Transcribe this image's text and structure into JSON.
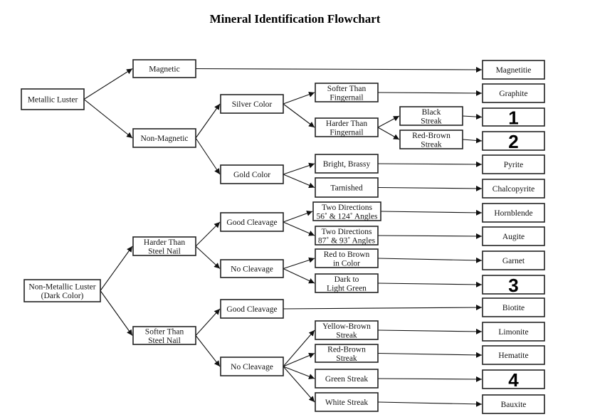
{
  "title": "Mineral Identification Flowchart",
  "nodes": [
    {
      "id": "metallic",
      "lines": [
        "Metallic Luster"
      ]
    },
    {
      "id": "magnetic",
      "lines": [
        "Magnetic"
      ]
    },
    {
      "id": "nonmagnetic",
      "lines": [
        "Non-Magnetic"
      ]
    },
    {
      "id": "silver",
      "lines": [
        "Silver Color"
      ]
    },
    {
      "id": "gold",
      "lines": [
        "Gold Color"
      ]
    },
    {
      "id": "softer_fingernail",
      "lines": [
        "Softer Than",
        "Fingernail"
      ]
    },
    {
      "id": "harder_fingernail",
      "lines": [
        "Harder Than",
        "Fingernail"
      ]
    },
    {
      "id": "black_streak",
      "lines": [
        "Black",
        "Streak"
      ]
    },
    {
      "id": "redbrown_streak_1",
      "lines": [
        "Red-Brown",
        "Streak"
      ]
    },
    {
      "id": "bright_brassy",
      "lines": [
        "Bright, Brassy"
      ]
    },
    {
      "id": "tarnished",
      "lines": [
        "Tarnished"
      ]
    },
    {
      "id": "nonmetallic",
      "lines": [
        "Non-Metallic Luster",
        "(Dark Color)"
      ]
    },
    {
      "id": "harder_nail",
      "lines": [
        "Harder Than",
        "Steel Nail"
      ]
    },
    {
      "id": "softer_nail",
      "lines": [
        "Softer Than",
        "Steel Nail"
      ]
    },
    {
      "id": "good_cleavage_1",
      "lines": [
        "Good Cleavage"
      ]
    },
    {
      "id": "no_cleavage_1",
      "lines": [
        "No Cleavage"
      ]
    },
    {
      "id": "good_cleavage_2",
      "lines": [
        "Good Cleavage"
      ]
    },
    {
      "id": "no_cleavage_2",
      "lines": [
        "No Cleavage"
      ]
    },
    {
      "id": "two_dir_56",
      "lines": [
        "Two Directions",
        "56˚ & 124˚ Angles"
      ]
    },
    {
      "id": "two_dir_87",
      "lines": [
        "Two Directions",
        "87˚ & 93˚ Angles"
      ]
    },
    {
      "id": "red_brown_color",
      "lines": [
        "Red to Brown",
        "in Color"
      ]
    },
    {
      "id": "dark_light_green",
      "lines": [
        "Dark to",
        "Light Green"
      ]
    },
    {
      "id": "yellowbrown_streak",
      "lines": [
        "Yellow-Brown",
        "Streak"
      ]
    },
    {
      "id": "redbrown_streak_2",
      "lines": [
        "Red-Brown",
        "Streak"
      ]
    },
    {
      "id": "green_streak",
      "lines": [
        "Green Streak"
      ]
    },
    {
      "id": "white_streak",
      "lines": [
        "White Streak"
      ]
    },
    {
      "id": "magnetitie",
      "lines": [
        "Magnetitie"
      ],
      "result": true
    },
    {
      "id": "graphite",
      "lines": [
        "Graphite"
      ],
      "result": true
    },
    {
      "id": "unknown_1",
      "lines": [
        "1"
      ],
      "result": true,
      "big": true
    },
    {
      "id": "unknown_2",
      "lines": [
        "2"
      ],
      "result": true,
      "big": true
    },
    {
      "id": "pyrite",
      "lines": [
        "Pyrite"
      ],
      "result": true
    },
    {
      "id": "chalcopyrite",
      "lines": [
        "Chalcopyrite"
      ],
      "result": true
    },
    {
      "id": "hornblende",
      "lines": [
        "Hornblende"
      ],
      "result": true
    },
    {
      "id": "augite",
      "lines": [
        "Augite"
      ],
      "result": true
    },
    {
      "id": "garnet",
      "lines": [
        "Garnet"
      ],
      "result": true
    },
    {
      "id": "unknown_3",
      "lines": [
        "3"
      ],
      "result": true,
      "big": true
    },
    {
      "id": "biotite",
      "lines": [
        "Biotite"
      ],
      "result": true
    },
    {
      "id": "limonite",
      "lines": [
        "Limonite"
      ],
      "result": true
    },
    {
      "id": "hematite",
      "lines": [
        "Hematite"
      ],
      "result": true
    },
    {
      "id": "unknown_4",
      "lines": [
        "4"
      ],
      "result": true,
      "big": true
    },
    {
      "id": "bauxite",
      "lines": [
        "Bauxite"
      ],
      "result": true
    }
  ],
  "edges": [
    [
      "metallic",
      "magnetic"
    ],
    [
      "metallic",
      "nonmagnetic"
    ],
    [
      "magnetic",
      "magnetitie"
    ],
    [
      "nonmagnetic",
      "silver"
    ],
    [
      "nonmagnetic",
      "gold"
    ],
    [
      "silver",
      "softer_fingernail"
    ],
    [
      "silver",
      "harder_fingernail"
    ],
    [
      "softer_fingernail",
      "graphite"
    ],
    [
      "harder_fingernail",
      "black_streak"
    ],
    [
      "harder_fingernail",
      "redbrown_streak_1"
    ],
    [
      "black_streak",
      "unknown_1"
    ],
    [
      "redbrown_streak_1",
      "unknown_2"
    ],
    [
      "gold",
      "bright_brassy"
    ],
    [
      "gold",
      "tarnished"
    ],
    [
      "bright_brassy",
      "pyrite"
    ],
    [
      "tarnished",
      "chalcopyrite"
    ],
    [
      "nonmetallic",
      "harder_nail"
    ],
    [
      "nonmetallic",
      "softer_nail"
    ],
    [
      "harder_nail",
      "good_cleavage_1"
    ],
    [
      "harder_nail",
      "no_cleavage_1"
    ],
    [
      "good_cleavage_1",
      "two_dir_56"
    ],
    [
      "good_cleavage_1",
      "two_dir_87"
    ],
    [
      "two_dir_56",
      "hornblende"
    ],
    [
      "two_dir_87",
      "augite"
    ],
    [
      "no_cleavage_1",
      "red_brown_color"
    ],
    [
      "no_cleavage_1",
      "dark_light_green"
    ],
    [
      "red_brown_color",
      "garnet"
    ],
    [
      "dark_light_green",
      "unknown_3"
    ],
    [
      "softer_nail",
      "good_cleavage_2"
    ],
    [
      "softer_nail",
      "no_cleavage_2"
    ],
    [
      "good_cleavage_2",
      "biotite"
    ],
    [
      "no_cleavage_2",
      "yellowbrown_streak"
    ],
    [
      "no_cleavage_2",
      "redbrown_streak_2"
    ],
    [
      "no_cleavage_2",
      "green_streak"
    ],
    [
      "no_cleavage_2",
      "white_streak"
    ],
    [
      "yellowbrown_streak",
      "limonite"
    ],
    [
      "redbrown_streak_2",
      "hematite"
    ],
    [
      "green_streak",
      "unknown_4"
    ],
    [
      "white_streak",
      "bauxite"
    ]
  ]
}
